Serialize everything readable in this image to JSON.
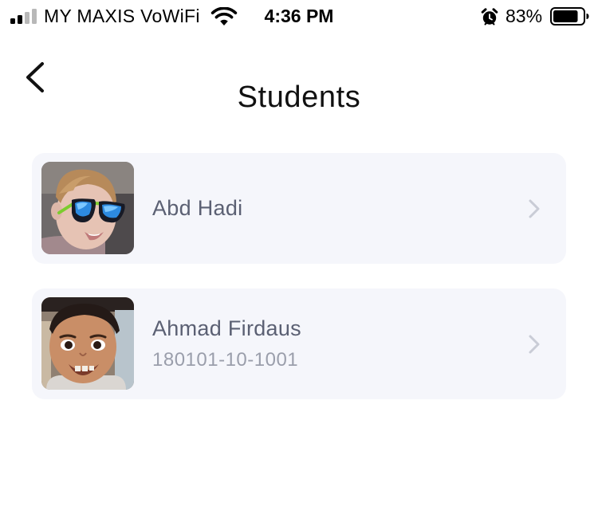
{
  "status_bar": {
    "carrier": "MY MAXIS VoWiFi",
    "time": "4:36 PM",
    "battery_percent": "83%",
    "battery_level": 0.83,
    "signal_bars_filled": 2,
    "signal_bars_total": 4,
    "icons": [
      "signal-icon",
      "wifi-icon",
      "alarm-icon",
      "battery-icon"
    ]
  },
  "nav": {
    "title": "Students",
    "back_icon": "chevron-left-icon"
  },
  "students": [
    {
      "name": "Abd Hadi",
      "id_number": "",
      "avatar": "student-photo"
    },
    {
      "name": "Ahmad Firdaus",
      "id_number": "180101-10-1001",
      "avatar": "student-photo"
    }
  ],
  "colors": {
    "card_background": "#f5f6fb",
    "name_text": "#5b6073",
    "id_text": "#9a9eab",
    "chevron": "#c9ccd6",
    "signal_active": "#000000",
    "signal_inactive": "#b8b8b8"
  }
}
